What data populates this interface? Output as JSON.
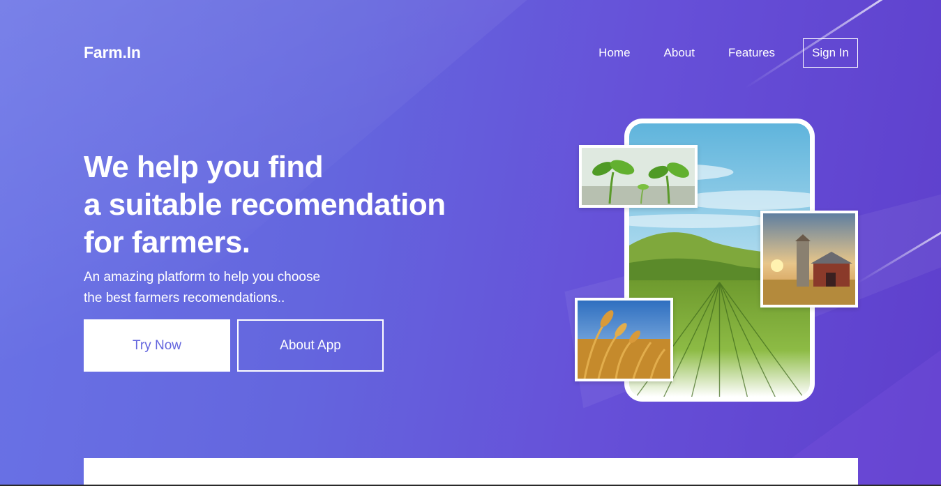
{
  "brand": {
    "logo": "Farm.In"
  },
  "nav": {
    "items": [
      {
        "label": "Home"
      },
      {
        "label": "About"
      },
      {
        "label": "Features"
      }
    ],
    "signin_label": "Sign In"
  },
  "hero": {
    "title_lines": [
      "We help you find",
      "a suitable recomendation",
      "for farmers."
    ],
    "subtitle_lines": [
      "An amazing platform to help you choose",
      "the best farmers recomendations.."
    ],
    "primary_button": "Try Now",
    "secondary_button": "About App"
  },
  "illustration": {
    "phone_image": "farm-field-landscape",
    "photos": [
      "sprouts",
      "barn-at-sunset",
      "wheat-field"
    ]
  },
  "colors": {
    "gradient_start": "#6a73e6",
    "gradient_end": "#5e3fcc",
    "primary_button_text": "#6466de",
    "white": "#ffffff"
  }
}
